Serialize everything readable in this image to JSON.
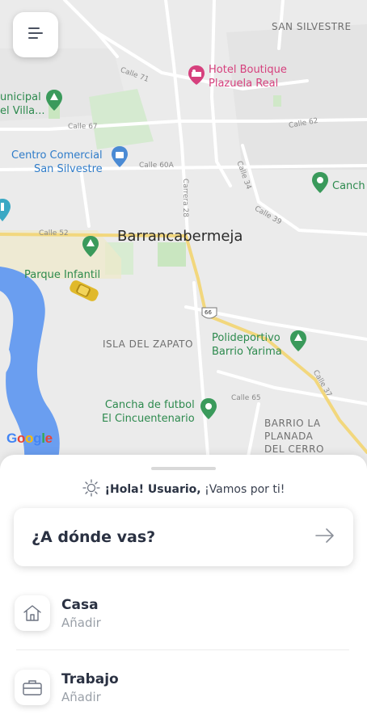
{
  "map": {
    "city": "Barrancabermeja",
    "streets": [
      "Calle 71",
      "Calle 67",
      "Calle 60A",
      "Carrera 28",
      "Calle 34",
      "Calle 39",
      "Calle 52",
      "Calle 37",
      "Calle 65",
      "Calle 62"
    ],
    "route_shield": "66",
    "pois": {
      "hotel": "Hotel Boutique\nPlazuela Real",
      "municipal": "unicipal\nel Villa...",
      "mall": "Centro Comercial\nSan Silvestre",
      "park": "Parque Infantil",
      "cancha_right": "Canch",
      "polideportivo": "Polideportivo\nBarrio Yarima",
      "cancha_futbol": "Cancha de futbol\nEl Cincuentenario"
    },
    "areas": {
      "san_silvestre": "SAN SILVESTRE",
      "isla": "ISLA DEL ZAPATO",
      "barrio": "BARRIO LA\nPLANADA\nDEL CERRO"
    },
    "google_logo": "Google"
  },
  "sheet": {
    "greeting_bold": "¡Hola! Usuario,",
    "greeting_rest": " ¡Vamos por ti!",
    "search_title": "¿A dónde vas?",
    "places": [
      {
        "title": "Casa",
        "subtitle": "Añadir",
        "icon": "home-icon"
      },
      {
        "title": "Trabajo",
        "subtitle": "Añadir",
        "icon": "briefcase-icon"
      }
    ]
  },
  "colors": {
    "map_bg": "#ebebeb",
    "road": "#ffffff",
    "highway": "#f4d77a",
    "river": "#6a9ef0",
    "park_green": "#c9e6c0",
    "poi_pink": "#d6407d",
    "poi_blue": "#2f7cc9",
    "poi_green": "#2d8a4e",
    "text_dark": "#2a3142"
  }
}
